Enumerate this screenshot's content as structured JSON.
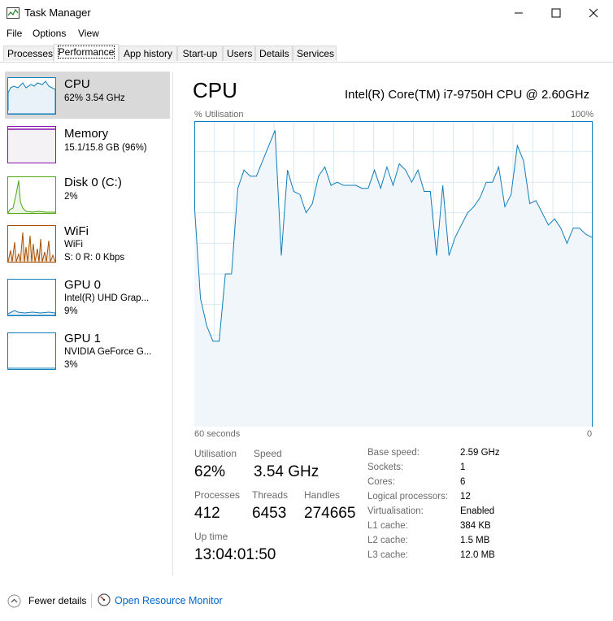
{
  "window": {
    "title": "Task Manager"
  },
  "menu": [
    "File",
    "Options",
    "View"
  ],
  "tabs": [
    "Processes",
    "Performance",
    "App history",
    "Start-up",
    "Users",
    "Details",
    "Services"
  ],
  "sidebar": {
    "items": [
      {
        "title": "CPU",
        "line1": "62% 3.54 GHz",
        "color": "#117dbb"
      },
      {
        "title": "Memory",
        "line1": "15.1/15.8 GB (96%)",
        "color": "#8b12ae"
      },
      {
        "title": "Disk 0 (C:)",
        "line1": "2%",
        "color": "#4da60c"
      },
      {
        "title": "WiFi",
        "line1": "WiFi",
        "line2": "S: 0 R: 0 Kbps",
        "color": "#a74f01"
      },
      {
        "title": "GPU 0",
        "line1": "Intel(R) UHD Grap...",
        "line2": "9%",
        "color": "#117dbb"
      },
      {
        "title": "GPU 1",
        "line1": "NVIDIA GeForce G...",
        "line2": "3%",
        "color": "#117dbb"
      }
    ]
  },
  "main": {
    "title": "CPU",
    "subtitle": "Intel(R) Core(TM) i7-9750H CPU @ 2.60GHz",
    "graph_label": "% Utilisation",
    "graph_max": "100%",
    "graph_time": "60 seconds",
    "graph_zero": "0",
    "stats": {
      "utilisation_label": "Utilisation",
      "utilisation": "62%",
      "speed_label": "Speed",
      "speed": "3.54 GHz",
      "processes_label": "Processes",
      "processes": "412",
      "threads_label": "Threads",
      "threads": "6453",
      "handles_label": "Handles",
      "handles": "274665",
      "uptime_label": "Up time",
      "uptime": "13:04:01:50"
    },
    "specs": [
      {
        "label": "Base speed:",
        "value": "2.59 GHz"
      },
      {
        "label": "Sockets:",
        "value": "1"
      },
      {
        "label": "Cores:",
        "value": "6"
      },
      {
        "label": "Logical processors:",
        "value": "12"
      },
      {
        "label": "Virtualisation:",
        "value": "Enabled"
      },
      {
        "label": "L1 cache:",
        "value": "384 KB"
      },
      {
        "label": "L2 cache:",
        "value": "1.5 MB"
      },
      {
        "label": "L3 cache:",
        "value": "12.0 MB"
      }
    ]
  },
  "footer": {
    "fewer_details": "Fewer details",
    "open_monitor": "Open Resource Monitor"
  },
  "chart_data": {
    "type": "area",
    "ylim": [
      0,
      100
    ],
    "series_values": [
      73,
      42,
      33,
      28,
      28,
      50,
      50,
      78,
      84,
      82,
      82,
      87,
      92,
      97,
      56,
      84,
      77,
      76,
      70,
      73,
      82,
      85,
      79,
      80,
      79,
      79,
      79,
      78,
      78,
      84,
      78,
      85,
      79,
      86,
      84,
      80,
      84,
      77,
      77,
      56,
      79,
      56,
      62,
      66,
      70,
      72,
      75,
      80,
      80,
      85,
      72,
      76,
      92,
      87,
      73,
      74,
      70,
      66,
      68,
      65,
      60,
      65,
      65,
      63,
      62
    ],
    "color": "#117dbb"
  }
}
